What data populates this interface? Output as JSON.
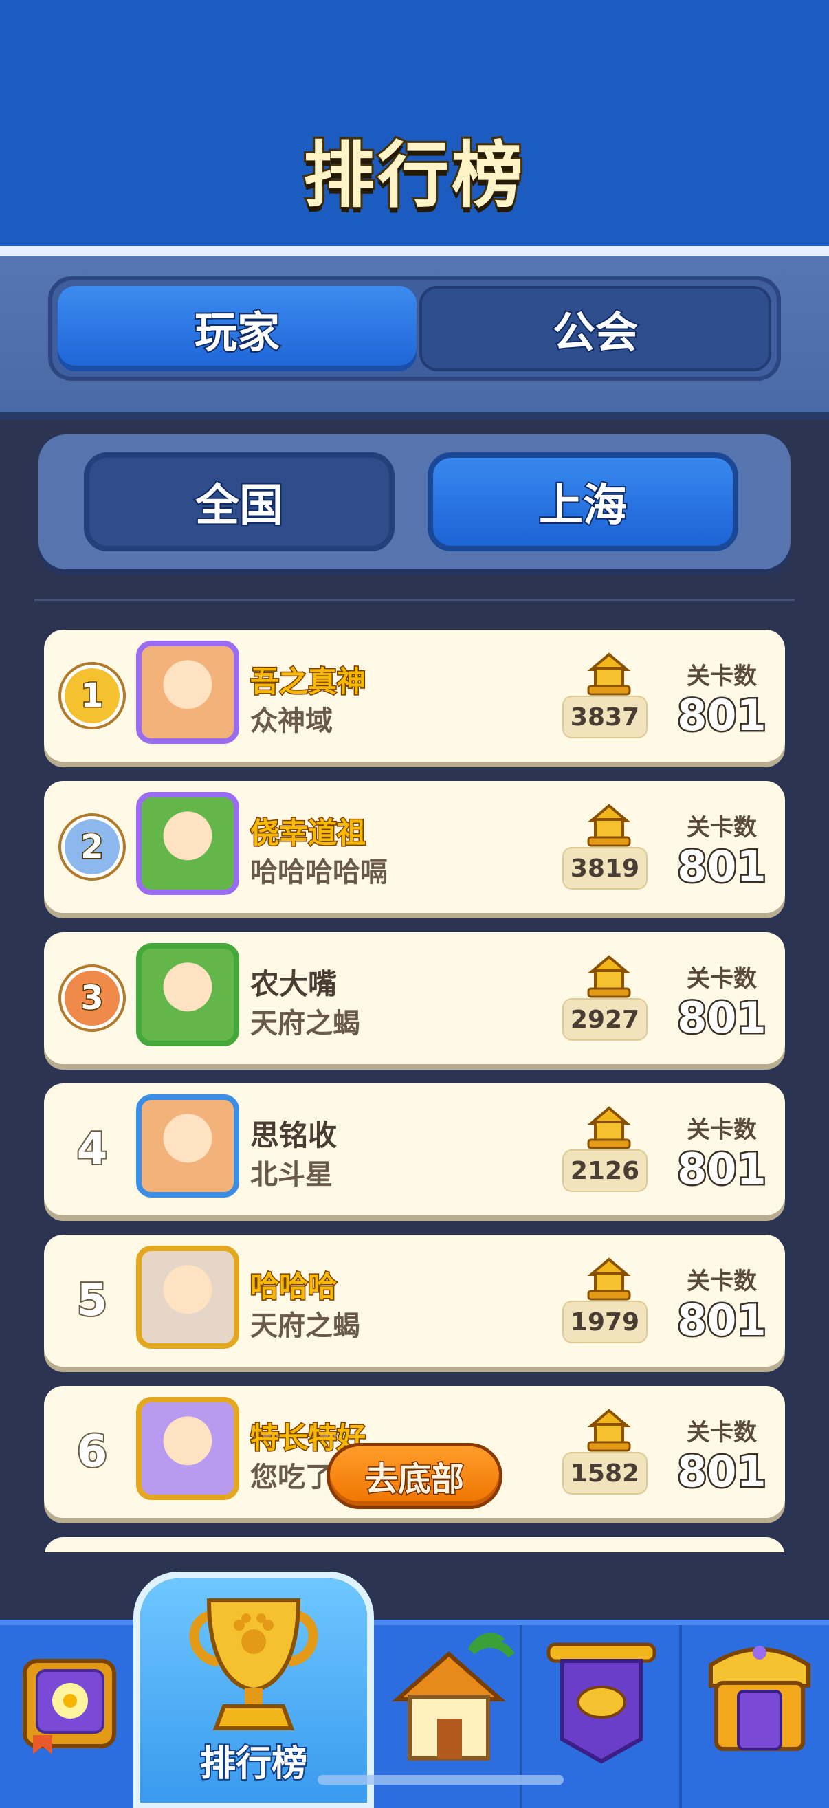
{
  "header": {
    "title": "排行榜"
  },
  "tabs": [
    {
      "label": "玩家",
      "active": true
    },
    {
      "label": "公会",
      "active": false
    }
  ],
  "regions": [
    {
      "label": "全国",
      "active": false
    },
    {
      "label": "上海",
      "active": true
    }
  ],
  "rows": [
    {
      "rank": "1",
      "name": "吾之真神",
      "guild": "众神域",
      "score": "3837",
      "levels_label": "关卡数",
      "levels": "801",
      "name_color": "gold",
      "avatar_frame": "#9a6df0",
      "avatar_bg": "#f3b27a",
      "medal": "#f6c12f"
    },
    {
      "rank": "2",
      "name": "侥幸道祖",
      "guild": "哈哈哈哈嗝",
      "score": "3819",
      "levels_label": "关卡数",
      "levels": "801",
      "name_color": "gold",
      "avatar_frame": "#9a6df0",
      "avatar_bg": "#63b64a",
      "medal": "#8db8ee"
    },
    {
      "rank": "3",
      "name": "农大嘴",
      "guild": "天府之蝎",
      "score": "2927",
      "levels_label": "关卡数",
      "levels": "801",
      "name_color": "plain",
      "avatar_frame": "#44a83a",
      "avatar_bg": "#63b64a",
      "medal": "#f08a4a"
    },
    {
      "rank": "4",
      "name": "思铭收",
      "guild": "北斗星",
      "score": "2126",
      "levels_label": "关卡数",
      "levels": "801",
      "name_color": "plain",
      "avatar_frame": "#3a8ee6",
      "avatar_bg": "#f3b27a"
    },
    {
      "rank": "5",
      "name": "哈哈哈",
      "guild": "天府之蝎",
      "score": "1979",
      "levels_label": "关卡数",
      "levels": "801",
      "name_color": "gold",
      "avatar_frame": "#e3a820",
      "avatar_bg": "#e6d6c8"
    },
    {
      "rank": "6",
      "name": "特长特好",
      "guild": "您吃了",
      "score": "1582",
      "levels_label": "关卡数",
      "levels": "801",
      "name_color": "gold",
      "avatar_frame": "#e3a820",
      "avatar_bg": "#b89af0"
    }
  ],
  "go_bottom_label": "去底部",
  "nav": {
    "active_label": "排行榜",
    "items": [
      "book-icon",
      "trophy-icon",
      "house-icon",
      "guild-banner-icon",
      "shop-icon"
    ]
  },
  "colors": {
    "header_blue": "#1c5cc0",
    "row_bg": "#fff9e6",
    "accent_orange": "#f07400"
  }
}
